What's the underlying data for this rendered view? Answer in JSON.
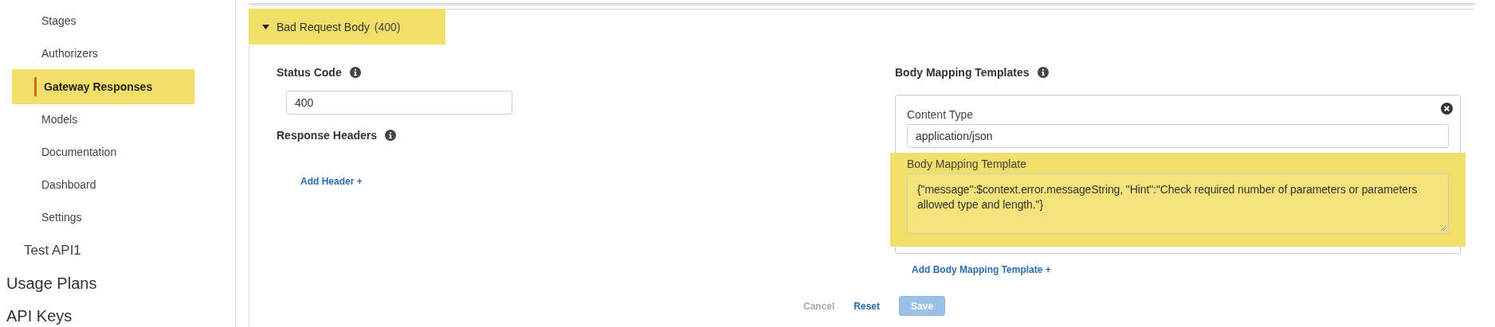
{
  "sidebar": {
    "items": [
      {
        "label": "Stages",
        "kind": "sub",
        "selected": false
      },
      {
        "label": "Authorizers",
        "kind": "sub",
        "selected": false
      },
      {
        "label": "Gateway Responses",
        "kind": "sub",
        "selected": true
      },
      {
        "label": "Models",
        "kind": "sub",
        "selected": false
      },
      {
        "label": "Documentation",
        "kind": "sub",
        "selected": false
      },
      {
        "label": "Dashboard",
        "kind": "sub",
        "selected": false
      },
      {
        "label": "Settings",
        "kind": "sub",
        "selected": false
      },
      {
        "label": "Test API1",
        "kind": "api",
        "selected": false
      },
      {
        "label": "Usage Plans",
        "kind": "top",
        "selected": false
      },
      {
        "label": "API Keys",
        "kind": "top",
        "selected": false
      }
    ]
  },
  "response": {
    "title": "Bad Request Body",
    "code": "(400)",
    "expanded": true,
    "highlighted": true,
    "status_code": {
      "label": "Status Code",
      "value": "400"
    },
    "response_headers": {
      "label": "Response Headers",
      "add_link": "Add Header +"
    },
    "body_mapping": {
      "label": "Body Mapping Templates",
      "templates": [
        {
          "content_type_label": "Content Type",
          "content_type": "application/json",
          "template_label": "Body Mapping Template",
          "template": "{\"message\":$context.error.messageString, \"Hint\":\"Check required number of parameters or parameters allowed type and length.\"}",
          "highlighted": true
        }
      ],
      "add_link": "Add Body Mapping Template +"
    },
    "buttons": [
      {
        "label": "Cancel",
        "kind": "link",
        "disabled": true
      },
      {
        "label": "Reset",
        "kind": "link",
        "disabled": false
      },
      {
        "label": "Save",
        "kind": "primary",
        "disabled": true
      }
    ]
  }
}
